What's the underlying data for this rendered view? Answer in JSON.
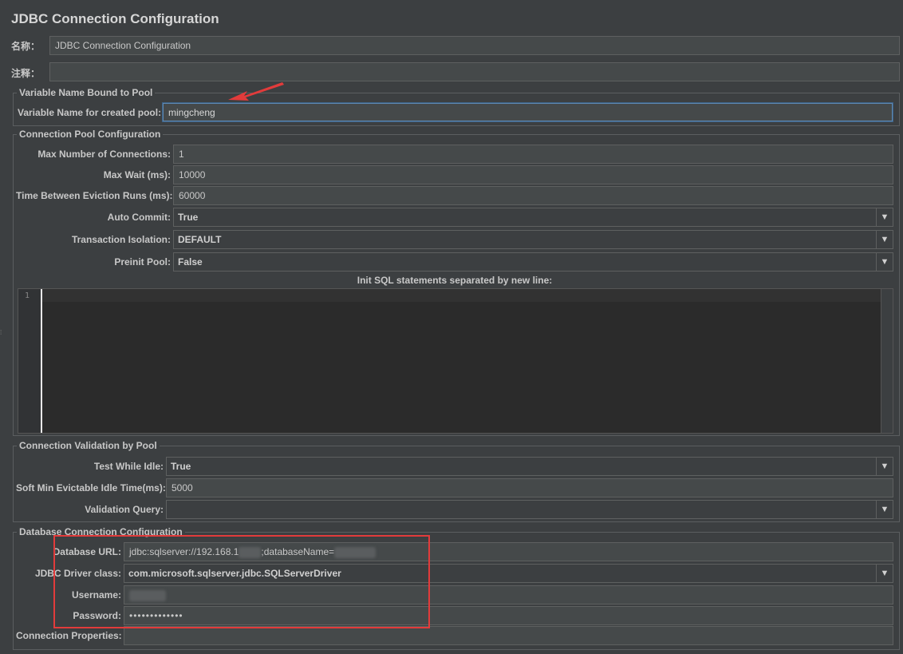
{
  "panel_title": "JDBC Connection Configuration",
  "name": {
    "label": "名称：",
    "value": "JDBC Connection Configuration"
  },
  "comment": {
    "label": "注释：",
    "value": ""
  },
  "variable_group": {
    "title": "Variable Name Bound to Pool",
    "label": "Variable Name for created pool:",
    "value": "mingcheng"
  },
  "pool_group": {
    "title": "Connection Pool Configuration",
    "max_connections": {
      "label": "Max Number of Connections:",
      "value": "1"
    },
    "max_wait": {
      "label": "Max Wait (ms):",
      "value": "10000"
    },
    "eviction": {
      "label": "Time Between Eviction Runs (ms):",
      "value": "60000"
    },
    "auto_commit": {
      "label": "Auto Commit:",
      "value": "True"
    },
    "isolation": {
      "label": "Transaction Isolation:",
      "value": "DEFAULT"
    },
    "preinit": {
      "label": "Preinit Pool:",
      "value": "False"
    },
    "init_sql_label": "Init SQL statements separated by new line:",
    "line_number": "1"
  },
  "validation_group": {
    "title": "Connection Validation by Pool",
    "test_idle": {
      "label": "Test While Idle:",
      "value": "True"
    },
    "soft_min": {
      "label": "Soft Min Evictable Idle Time(ms):",
      "value": "5000"
    },
    "query": {
      "label": "Validation Query:",
      "value": ""
    }
  },
  "db_group": {
    "title": "Database Connection Configuration",
    "url": {
      "label": "Database URL:",
      "value_a": "jdbc:sqlserver://192.168.1",
      "value_b": ";databaseName="
    },
    "driver": {
      "label": "JDBC Driver class:",
      "value": "com.microsoft.sqlserver.jdbc.SQLServerDriver"
    },
    "username": {
      "label": "Username:"
    },
    "password": {
      "label": "Password:",
      "value": "•••••••••••••"
    },
    "properties": {
      "label": "Connection Properties:",
      "value": ""
    }
  },
  "dropdown_glyph": "▼",
  "colors": {
    "annotation_red": "#e23b3b",
    "focus_blue": "#5e89b3",
    "background": "#3c3f41"
  },
  "icons": [
    "dropdown-arrow-icon",
    "red-annotation-arrow"
  ]
}
